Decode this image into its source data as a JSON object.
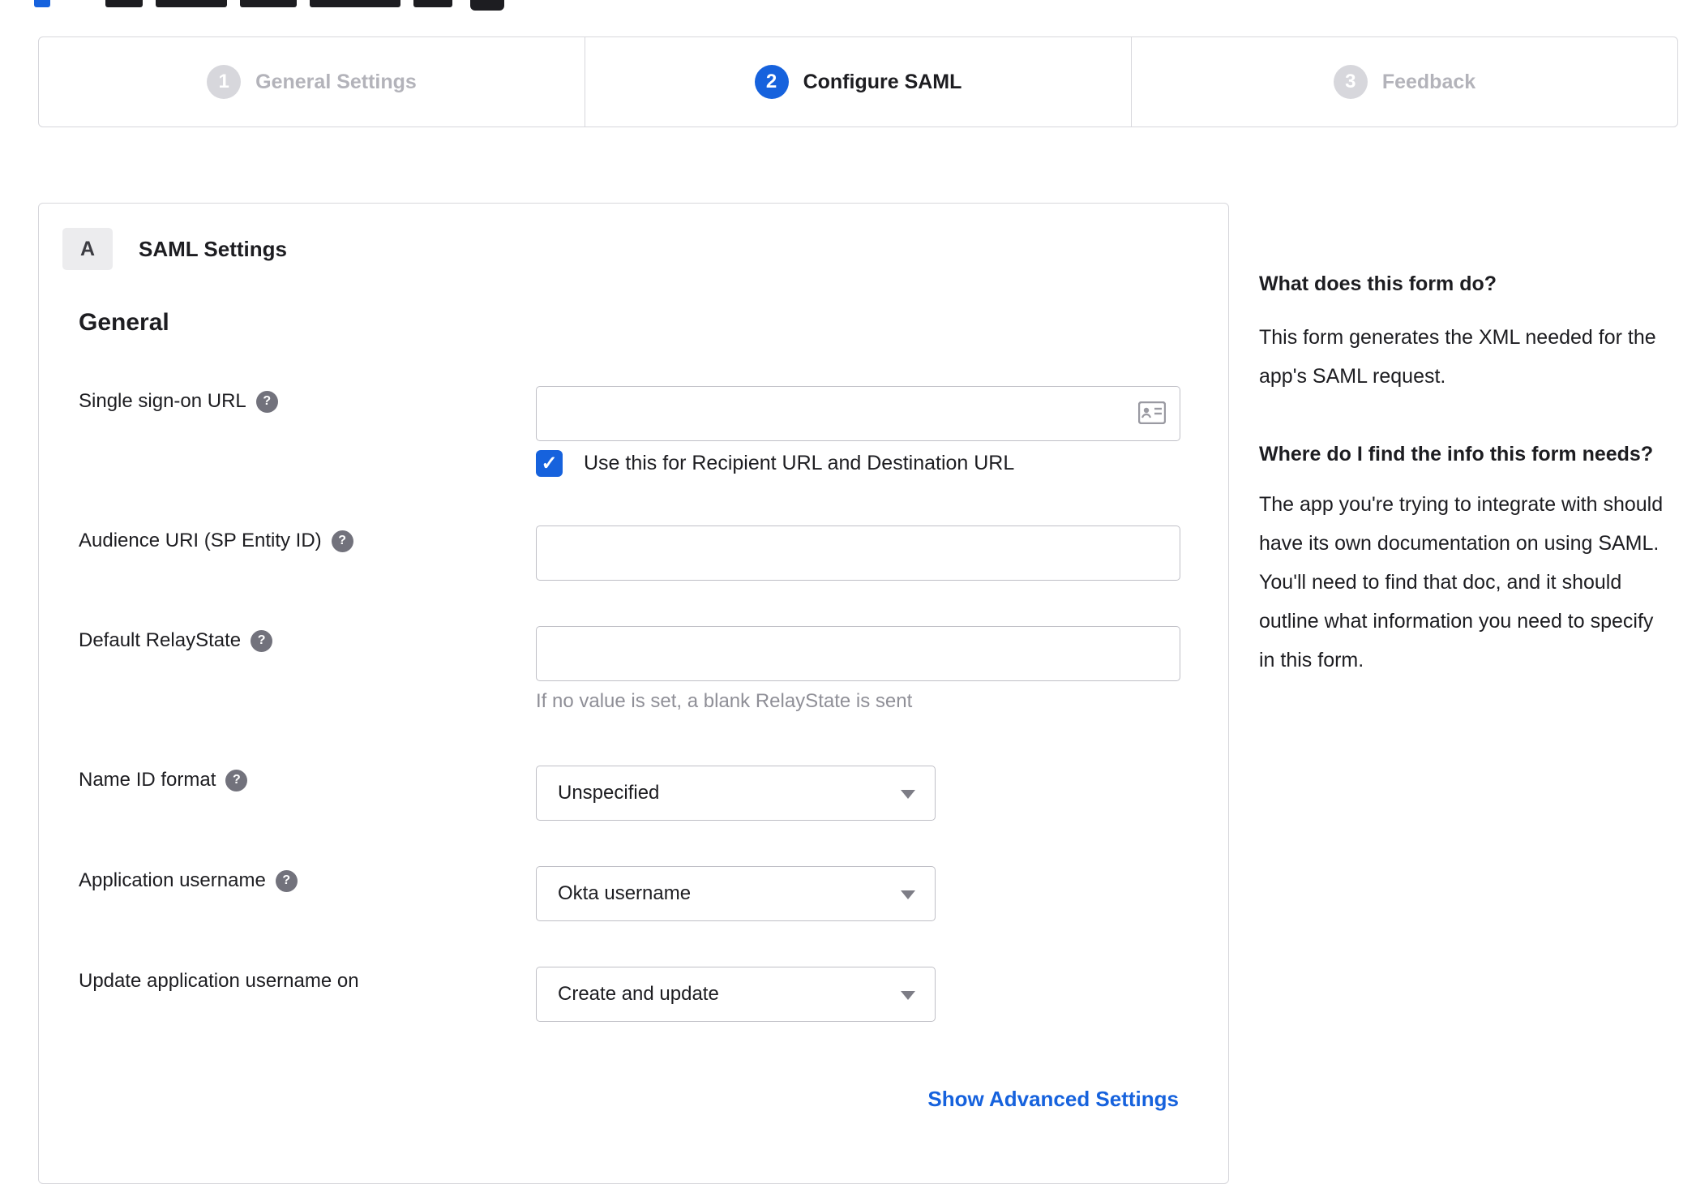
{
  "stepper": {
    "steps": [
      {
        "number": "1",
        "label": "General Settings",
        "state": "inactive"
      },
      {
        "number": "2",
        "label": "Configure SAML",
        "state": "active"
      },
      {
        "number": "3",
        "label": "Feedback",
        "state": "inactive"
      }
    ]
  },
  "panel": {
    "section_badge": "A",
    "section_title": "SAML Settings",
    "group_title": "General",
    "fields": {
      "sso": {
        "label": "Single sign-on URL",
        "value": "",
        "checkbox_label": "Use this for Recipient URL and Destination URL",
        "checkbox_checked": true
      },
      "audience": {
        "label": "Audience URI (SP Entity ID)",
        "value": ""
      },
      "relay": {
        "label": "Default RelayState",
        "value": "",
        "hint": "If no value is set, a blank RelayState is sent"
      },
      "nameid": {
        "label": "Name ID format",
        "value": "Unspecified"
      },
      "appusername": {
        "label": "Application username",
        "value": "Okta username"
      },
      "updateusername": {
        "label": "Update application username on",
        "value": "Create and update"
      }
    },
    "help_glyph": "?",
    "advanced_link": "Show Advanced Settings"
  },
  "sidebar": {
    "q1_title": "What does this form do?",
    "q1_body": "This form generates the XML needed for the app's SAML request.",
    "q2_title": "Where do I find the info this form needs?",
    "q2_body": "The app you're trying to integrate with should have its own documentation on using SAML. You'll need to find that doc, and it should outline what information you need to specify in this form."
  },
  "colors": {
    "accent": "#1662dd",
    "link": "#1662dd",
    "inactive_step": "#b3b3ba",
    "border": "#d7d7dc"
  }
}
